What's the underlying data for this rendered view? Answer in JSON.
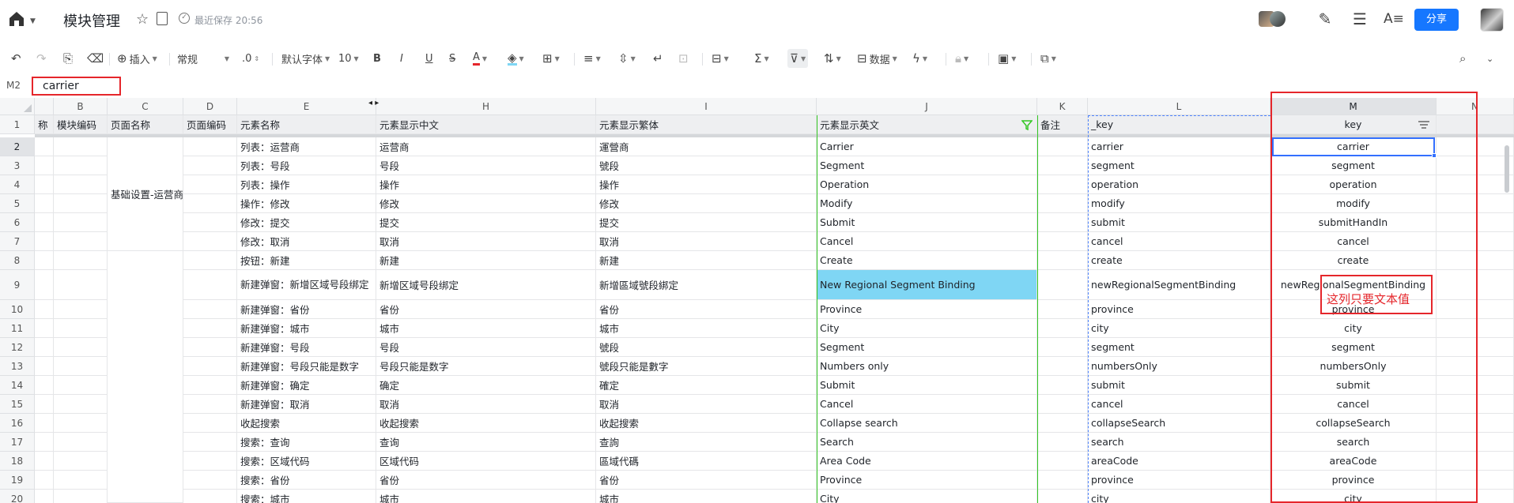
{
  "app": {
    "title": "模块管理",
    "save_status": "最近保存 20:56",
    "share_label": "分享",
    "icons": [
      "home-icon",
      "star-icon",
      "doc-icon",
      "check-circle-icon",
      "edit-icon",
      "menu-icon",
      "font-style-icon",
      "avatar"
    ]
  },
  "toolbar": {
    "insert_label": "插入",
    "format_label": "常规",
    "decimal_label": ".0",
    "font_label": "默认字体",
    "font_size": "10",
    "bold": "B",
    "italic": "I",
    "underline": "U",
    "strike": "S",
    "font_color": "A",
    "data_label": "数据"
  },
  "formula": {
    "cell_ref": "M2",
    "value": "carrier"
  },
  "columns": [
    {
      "letter": "",
      "header": "称"
    },
    {
      "letter": "B",
      "header": "模块编码"
    },
    {
      "letter": "C",
      "header": "页面名称"
    },
    {
      "letter": "D",
      "header": "页面编码"
    },
    {
      "letter": "E",
      "header": "元素名称"
    },
    {
      "letter": "H",
      "header": "元素显示中文"
    },
    {
      "letter": "I",
      "header": "元素显示繁体"
    },
    {
      "letter": "J",
      "header": "元素显示英文"
    },
    {
      "letter": "K",
      "header": "备注"
    },
    {
      "letter": "L",
      "header": "_key"
    },
    {
      "letter": "M",
      "header": "key"
    },
    {
      "letter": "N",
      "header": ""
    }
  ],
  "page_name_merged": "基础设置-运营商",
  "rows": [
    {
      "n": "1"
    },
    {
      "n": "2",
      "e": "列表：运营商",
      "h": "运营商",
      "i": "運營商",
      "j": "Carrier",
      "l": "carrier",
      "m": "carrier"
    },
    {
      "n": "3",
      "e": "列表：号段",
      "h": "号段",
      "i": "號段",
      "j": "Segment",
      "l": "segment",
      "m": "segment"
    },
    {
      "n": "4",
      "e": "列表：操作",
      "h": "操作",
      "i": "操作",
      "j": "Operation",
      "l": "operation",
      "m": "operation"
    },
    {
      "n": "5",
      "e": "操作：修改",
      "h": "修改",
      "i": "修改",
      "j": "Modify",
      "l": "modify",
      "m": "modify"
    },
    {
      "n": "6",
      "e": "修改：提交",
      "h": "提交",
      "i": "提交",
      "j": "Submit",
      "l": "submit",
      "m": "submitHandIn"
    },
    {
      "n": "7",
      "e": "修改：取消",
      "h": "取消",
      "i": "取消",
      "j": "Cancel",
      "l": "cancel",
      "m": "cancel"
    },
    {
      "n": "8",
      "e": "按钮：新建",
      "h": "新建",
      "i": "新建",
      "j": "Create",
      "l": "create",
      "m": "create"
    },
    {
      "n": "9",
      "e": "新建弹窗：新增区域号段绑定",
      "h": "新增区域号段绑定",
      "i": "新增區域號段綁定",
      "j": "New Regional Segment Binding",
      "l": "newRegionalSegmentBinding",
      "m": "newRegionalSegmentBinding"
    },
    {
      "n": "10",
      "e": "新建弹窗：省份",
      "h": "省份",
      "i": "省份",
      "j": "Province",
      "l": "province",
      "m": "province"
    },
    {
      "n": "11",
      "e": "新建弹窗：城市",
      "h": "城市",
      "i": "城市",
      "j": "City",
      "l": "city",
      "m": "city"
    },
    {
      "n": "12",
      "e": "新建弹窗：号段",
      "h": "号段",
      "i": "號段",
      "j": "Segment",
      "l": "segment",
      "m": "segment"
    },
    {
      "n": "13",
      "e": "新建弹窗：号段只能是数字",
      "h": "号段只能是数字",
      "i": "號段只能是數字",
      "j": "Numbers only",
      "l": "numbersOnly",
      "m": "numbersOnly"
    },
    {
      "n": "14",
      "e": "新建弹窗：确定",
      "h": "确定",
      "i": "確定",
      "j": "Submit",
      "l": "submit",
      "m": "submit"
    },
    {
      "n": "15",
      "e": "新建弹窗：取消",
      "h": "取消",
      "i": "取消",
      "j": "Cancel",
      "l": "cancel",
      "m": "cancel"
    },
    {
      "n": "16",
      "e": "收起搜索",
      "h": "收起搜索",
      "i": "收起搜索",
      "j": "Collapse search",
      "l": "collapseSearch",
      "m": "collapseSearch"
    },
    {
      "n": "17",
      "e": "搜索：查询",
      "h": "查询",
      "i": "查詢",
      "j": "Search",
      "l": "search",
      "m": "search"
    },
    {
      "n": "18",
      "e": "搜索：区域代码",
      "h": "区域代码",
      "i": "區域代碼",
      "j": "Area Code",
      "l": "areaCode",
      "m": "areaCode"
    },
    {
      "n": "19",
      "e": "搜索：省份",
      "h": "省份",
      "i": "省份",
      "j": "Province",
      "l": "province",
      "m": "province"
    },
    {
      "n": "20",
      "e": "搜索：城市",
      "h": "城市",
      "i": "城市",
      "j": "City",
      "l": "city",
      "m": "city"
    }
  ],
  "annotation": "这列只要文本值",
  "colors": {
    "accent": "#1677ff",
    "highlight_cell": "#7fd6f4",
    "annotation_red": "#e5262b",
    "filter_green": "#34c724",
    "selection_blue": "#3370ff"
  }
}
